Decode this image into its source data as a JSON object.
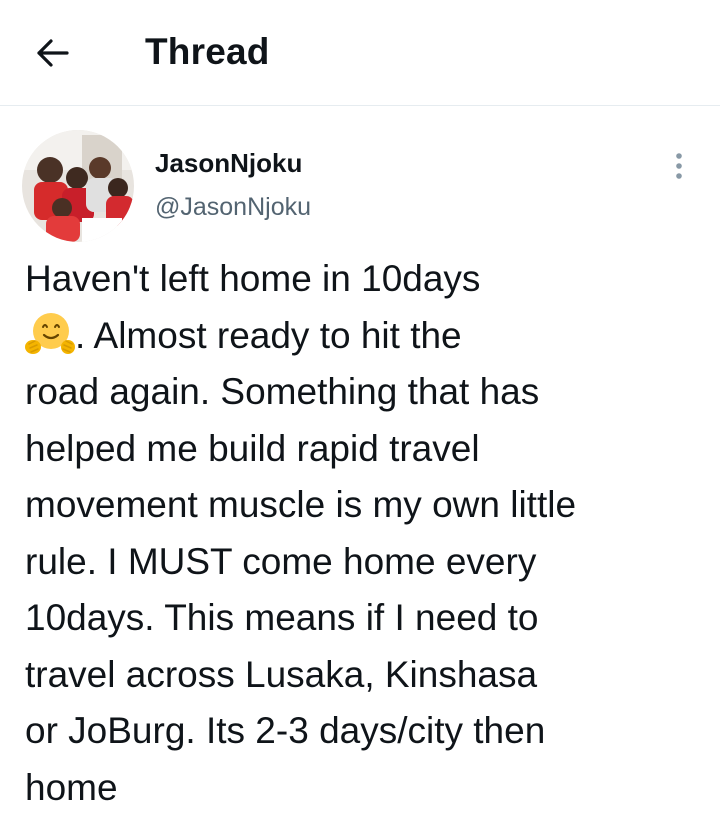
{
  "header": {
    "title": "Thread",
    "back_icon": "arrow-left-icon"
  },
  "tweet": {
    "author": {
      "display_name": "JasonNjoku",
      "handle": "@JasonNjoku"
    },
    "more_icon": "more-vertical-icon",
    "emoji": "hugging-face-emoji",
    "lines": [
      "Haven't left home in 10days",
      ". Almost ready to hit the",
      "road again. Something that has",
      "helped me build rapid travel",
      "movement muscle is my own little",
      "rule. I MUST come home every",
      "10days. This means if I need to",
      "travel across Lusaka, Kinshasa",
      "or JoBurg. Its 2-3 days/city then",
      "home"
    ]
  },
  "colors": {
    "text": "#0f1419",
    "secondary": "#536471",
    "divider": "#e6ecf0"
  }
}
